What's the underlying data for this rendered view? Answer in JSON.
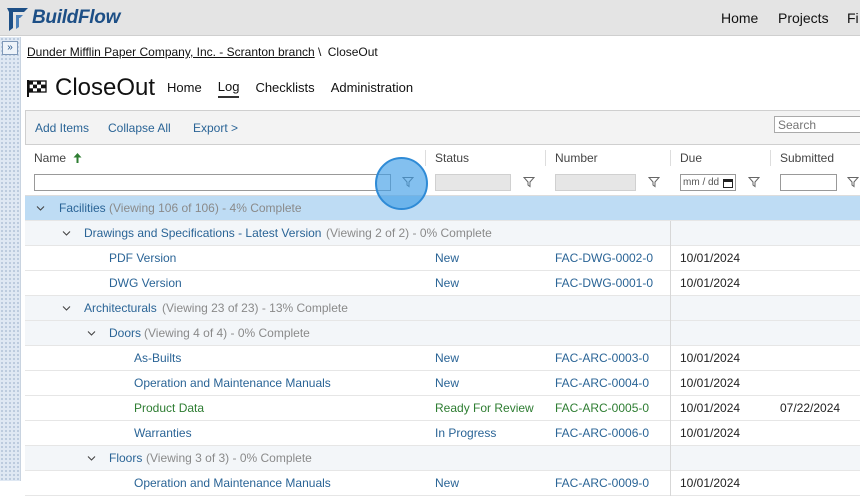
{
  "app": {
    "brand": "BuildFlow",
    "nav": [
      "Home",
      "Projects",
      "Fi"
    ]
  },
  "breadcrumb": {
    "company": "Dunder Mifflin Paper Company, Inc. - Scranton branch",
    "separator": "\\",
    "current": "CloseOut"
  },
  "page": {
    "title": "CloseOut",
    "tabs": [
      "Home",
      "Log",
      "Checklists",
      "Administration"
    ],
    "active_tab": "Log"
  },
  "toolbar": {
    "add_items": "Add Items",
    "collapse_all": "Collapse All",
    "export": "Export >",
    "search_placeholder": "Search"
  },
  "columns": {
    "name": "Name",
    "status": "Status",
    "number": "Number",
    "due": "Due",
    "submitted": "Submitted",
    "due_placeholder": "mm / dd"
  },
  "rows": [
    {
      "kind": "group1",
      "label": "Facilities",
      "meta": "(Viewing 106 of 106) - 4% Complete"
    },
    {
      "kind": "group2",
      "label": "Drawings and Specifications - Latest Version",
      "meta": "(Viewing 2 of 2) - 0% Complete"
    },
    {
      "kind": "item",
      "name": "PDF Version",
      "status": "New",
      "number": "FAC-DWG-0002-0",
      "due": "10/01/2024",
      "submitted": ""
    },
    {
      "kind": "item",
      "name": "DWG Version",
      "status": "New",
      "number": "FAC-DWG-0001-0",
      "due": "10/01/2024",
      "submitted": ""
    },
    {
      "kind": "group2",
      "label": "Architecturals",
      "meta": "(Viewing 23 of 23) - 13% Complete"
    },
    {
      "kind": "group3",
      "label": "Doors",
      "meta": "(Viewing 4 of 4) - 0% Complete"
    },
    {
      "kind": "item",
      "name": "As-Builts",
      "status": "New",
      "number": "FAC-ARC-0003-0",
      "due": "10/01/2024",
      "submitted": ""
    },
    {
      "kind": "item",
      "name": "Operation and Maintenance Manuals",
      "status": "New",
      "number": "FAC-ARC-0004-0",
      "due": "10/01/2024",
      "submitted": ""
    },
    {
      "kind": "item",
      "name": "Product Data",
      "status": "Ready For Review",
      "number": "FAC-ARC-0005-0",
      "due": "10/01/2024",
      "submitted": "07/22/2024"
    },
    {
      "kind": "item",
      "name": "Warranties",
      "status": "In Progress",
      "number": "FAC-ARC-0006-0",
      "due": "10/01/2024",
      "submitted": ""
    },
    {
      "kind": "group3",
      "label": "Floors",
      "meta": "(Viewing 3 of 3) - 0% Complete"
    },
    {
      "kind": "item",
      "name": "Operation and Maintenance Manuals",
      "status": "New",
      "number": "FAC-ARC-0009-0",
      "due": "10/01/2024",
      "submitted": ""
    }
  ],
  "colors": {
    "brand": "#1d4f86",
    "link": "#2a6496",
    "ready": "#2e7d32",
    "group_highlight": "#bedcf4"
  }
}
